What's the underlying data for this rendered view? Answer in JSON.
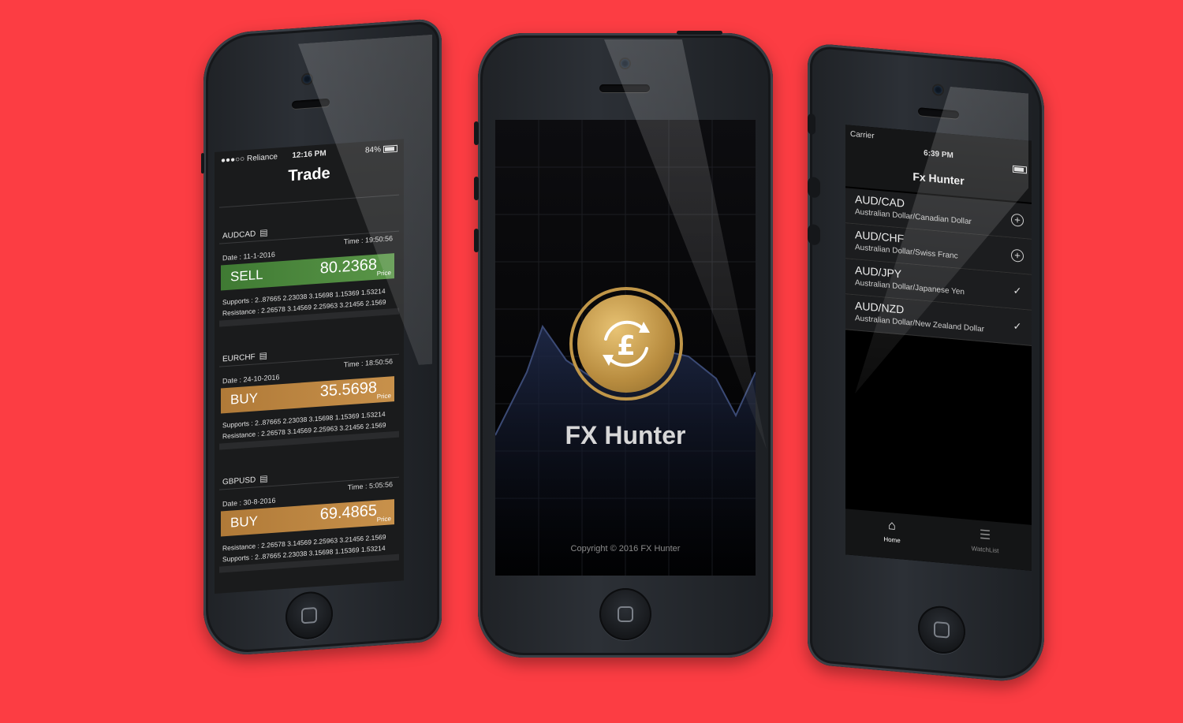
{
  "colors": {
    "background": "#fc3d43",
    "sell": "#4c8a3c",
    "buy": "#bd8744",
    "gold": "#c09648"
  },
  "trade_screen": {
    "status": {
      "carrier": "●●●○○ Reliance",
      "time": "12:16 PM",
      "battery": "84%"
    },
    "title": "Trade",
    "price_label": "Price",
    "trades": [
      {
        "pair": "AUDCAD",
        "date": "Date : 11-1-2016",
        "time": "Time : 19:50:56",
        "action": "SELL",
        "price": "80.2368",
        "rows": [
          {
            "label": "Supports",
            "values": ": 2..87665  2.23038  3.15698  1.15369  1.53214"
          },
          {
            "label": "Resistance",
            "values": ": 2.26578  3.14569  2.25963  3.21456  2.1569"
          }
        ]
      },
      {
        "pair": "EURCHF",
        "date": "Date : 24-10-2016",
        "time": "Time : 18:50:56",
        "action": "BUY",
        "price": "35.5698",
        "rows": [
          {
            "label": "Supports",
            "values": ": 2..87665  2.23038  3.15698  1.15369  1.53214"
          },
          {
            "label": "Resistance",
            "values": ": 2.26578  3.14569  2.25963  3.21456  2.1569"
          }
        ]
      },
      {
        "pair": "GBPUSD",
        "date": "Date : 30-8-2016",
        "time": "Time : 5:05:56",
        "action": "BUY",
        "price": "69.4865",
        "rows": [
          {
            "label": "Resistance",
            "values": ": 2.26578  3.14569  2.25963  3.21456  2.1569"
          },
          {
            "label": "Supports",
            "values": ": 2..87665  2.23038  3.15698  1.15369  1.53214"
          }
        ]
      }
    ]
  },
  "splash_screen": {
    "app_name": "FX Hunter",
    "copyright": "Copyright © 2016 FX Hunter",
    "logo_icon": "currency-exchange-icon"
  },
  "watchlist_screen": {
    "status": {
      "carrier": "Carrier",
      "time": "6:39 PM"
    },
    "title": "Fx Hunter",
    "items": [
      {
        "code": "AUD/CAD",
        "name": "Australian Dollar/Canadian Dollar",
        "action": "add-icon"
      },
      {
        "code": "AUD/CHF",
        "name": "Australian Dollar/Swiss Franc",
        "action": "add-icon"
      },
      {
        "code": "AUD/JPY",
        "name": "Australian Dollar/Japanese Yen",
        "action": "checkmark-icon"
      },
      {
        "code": "AUD/NZD",
        "name": "Australian Dollar/New Zealand Dollar",
        "action": "checkmark-icon"
      }
    ],
    "tabs": [
      {
        "label": "Home",
        "icon": "home-icon"
      },
      {
        "label": "WatchList",
        "icon": "list-icon"
      }
    ]
  }
}
